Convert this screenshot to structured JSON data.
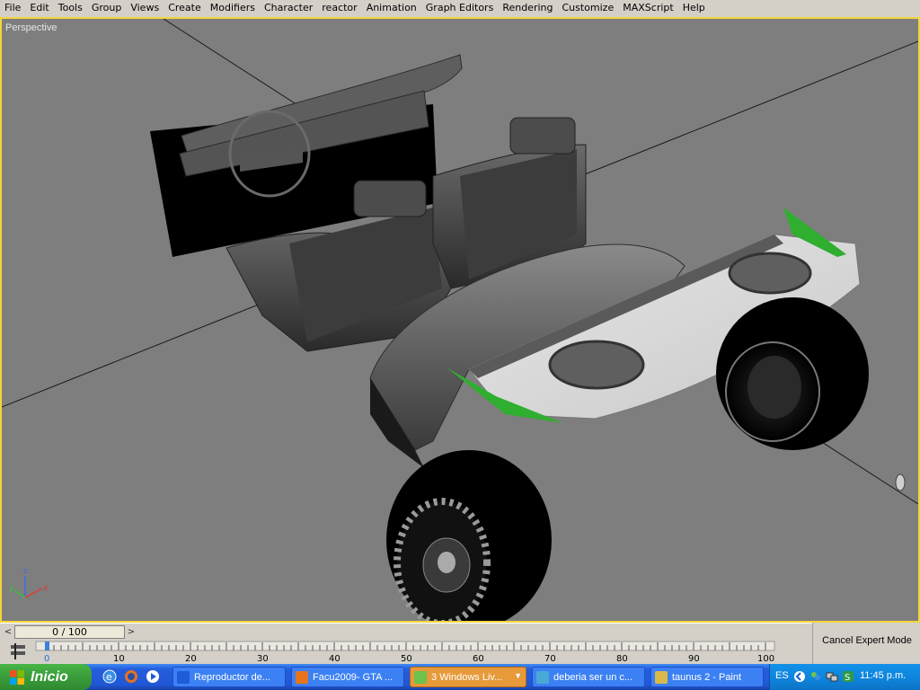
{
  "menu": [
    "File",
    "Edit",
    "Tools",
    "Group",
    "Views",
    "Create",
    "Modifiers",
    "Character",
    "reactor",
    "Animation",
    "Graph Editors",
    "Rendering",
    "Customize",
    "MAXScript",
    "Help"
  ],
  "viewport": {
    "label": "Perspective",
    "border_color": "#f2d63a",
    "background": "#7e7e7e"
  },
  "axis_gizmo": {
    "x": "x",
    "y": "y",
    "z": "z"
  },
  "time_slider": {
    "value": "0 / 100",
    "left_arrow": "<",
    "right_arrow": ">"
  },
  "track_bar": {
    "ticks": [
      "0",
      "10",
      "20",
      "30",
      "40",
      "50",
      "60",
      "70",
      "80",
      "90",
      "100"
    ],
    "current_frame": "0"
  },
  "status": {
    "cancel_expert_mode": "Cancel Expert Mode"
  },
  "taskbar": {
    "start_label": "Inicio",
    "quick_launch": [
      "ie-icon",
      "firefox-icon",
      "media-player-icon"
    ],
    "tasks": [
      {
        "label": "Reproductor de...",
        "icon": "media-player-icon",
        "color": "#1e5bd6"
      },
      {
        "label": "Facu2009- GTA ...",
        "icon": "firefox-icon",
        "color": "#e8731d"
      },
      {
        "label": "3 Windows Liv...",
        "icon": "messenger-icon",
        "color": "#6cc24a",
        "active": true
      },
      {
        "label": "deberia ser un c...",
        "icon": "3dsmax-icon",
        "color": "#4aa8d6"
      },
      {
        "label": "taunus 2 - Paint",
        "icon": "paint-icon",
        "color": "#d9b84a"
      }
    ],
    "tray": {
      "language": "ES",
      "clock": "11:45 p.m."
    }
  }
}
